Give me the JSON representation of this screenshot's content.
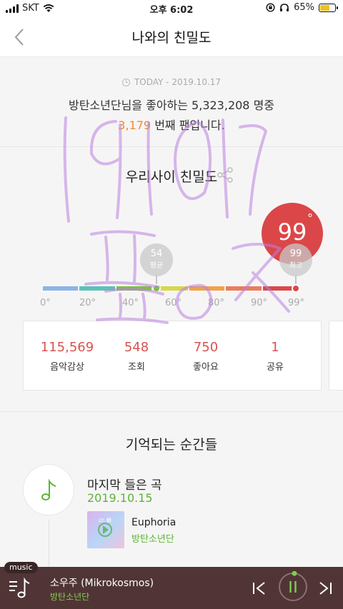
{
  "status_bar": {
    "carrier": "SKT",
    "time": "오후 6:02",
    "battery": "65%",
    "battery_level": 0.65
  },
  "header": {
    "title": "나와의 친밀도",
    "back_icon": "chevron-left-icon"
  },
  "summary": {
    "today_label": "TODAY - 2019.10.17",
    "line1": "방탄소년단님을 좋아하는 5,323,208 명중",
    "rank": "3,179",
    "rank_suffix": " 번째 팬입니다."
  },
  "intimacy": {
    "title": "우리사이 친밀도",
    "score": "99",
    "score_unit": "°",
    "average": {
      "value": "54",
      "label": "평균"
    },
    "best": {
      "value": "99",
      "label": "최고"
    },
    "ticks": [
      "0°",
      "20°",
      "40°",
      "60°",
      "80°",
      "90°",
      "99°"
    ],
    "bar_colors": [
      "#8ab4e8",
      "#5bc3b5",
      "#7cc33a",
      "#d6d848",
      "#f0a24a",
      "#ea7d5c",
      "#d9484a"
    ],
    "stats": [
      {
        "value": "115,569",
        "label": "음악감상"
      },
      {
        "value": "548",
        "label": "조회"
      },
      {
        "value": "750",
        "label": "좋아요"
      },
      {
        "value": "1",
        "label": "공유"
      }
    ]
  },
  "moments": {
    "title": "기억되는 순간들",
    "item_title": "마지막 들은 곡",
    "item_date": "2019.10.15",
    "album_title": "Euphoria",
    "album_artist": "방탄소년단",
    "album_badge": "LY: 轉"
  },
  "player": {
    "tag": "music",
    "title": "소우주 (Mikrokosmos)",
    "artist": "방탄소년단"
  },
  "handwriting": [
    "191017",
    "ㅍㅍㅇㅈ"
  ],
  "colors": {
    "accent_red": "#db4748",
    "accent_green": "#5bb536",
    "accent_orange": "#f08a2c",
    "player_bg": "#513536"
  }
}
